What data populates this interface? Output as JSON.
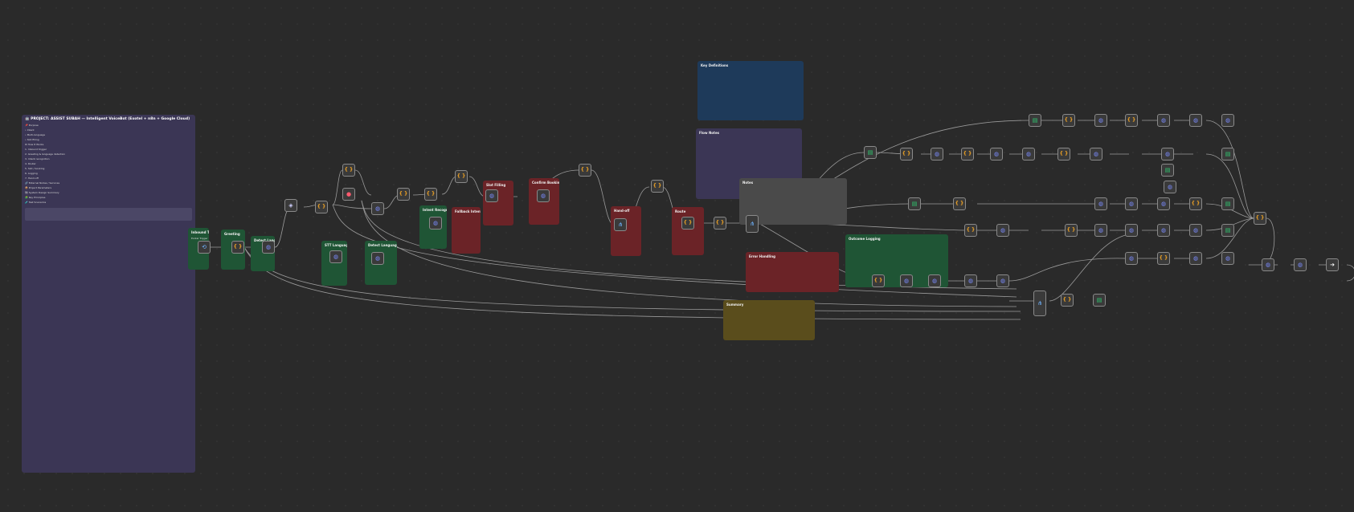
{
  "canvas": {
    "background": "#2a2a2a",
    "wire_color": "#9a9a9a"
  },
  "main_note": {
    "title": "🤖 PROJECT: ASSIST SUBAH — Intelligent VoiceBot (Exotel + n8n + Google Cloud)",
    "color": "#3b3655",
    "lines": [
      "📌 Purpose",
      "",
      "",
      "• Intent",
      "• Multi-language",
      "• Slot filling",
      "",
      "",
      "⚙ How It Works",
      "1. Inbound trigger",
      "",
      "2. Greeting & language detection",
      "",
      "",
      "3. Intent recognition",
      "",
      "",
      "4. Router",
      "",
      "",
      "",
      "",
      "",
      "5. Slot / booking",
      "",
      "",
      "",
      "",
      "6. Logging",
      "",
      "",
      "",
      "7. Hand-off",
      "",
      "",
      "🔗 External Nodes / Services",
      "",
      "",
      "",
      "",
      "",
      "",
      "📦 Project Parameters",
      "",
      "",
      "",
      "",
      "",
      "",
      "",
      "",
      "🗺 System Design Summary",
      "",
      "",
      "",
      "",
      "",
      "🧩 Key Principles",
      "",
      "",
      "",
      "",
      "",
      "🧪 Test Scenarios",
      "",
      ""
    ]
  },
  "notes": [
    {
      "id": "n-inbound",
      "title": "Inbound Trigger",
      "color": "#1f5535",
      "lines": [
        "Exotel Trigger",
        "",
        "",
        ""
      ]
    },
    {
      "id": "n-greet",
      "title": "Greeting",
      "color": "#1f5535",
      "lines": [
        "",
        "",
        "",
        ""
      ]
    },
    {
      "id": "n-lang",
      "title": "Detect Language",
      "color": "#1f5535",
      "lines": [
        "",
        ""
      ]
    },
    {
      "id": "n-lang2",
      "title": "STT Language",
      "color": "#1f5535",
      "lines": [
        "",
        "",
        ""
      ]
    },
    {
      "id": "n-detect-ai",
      "title": "Detect Language (API)",
      "color": "#1f5535",
      "lines": [
        "",
        "",
        ""
      ]
    },
    {
      "id": "n-intent",
      "title": "Intent Recognition",
      "color": "#1f5535",
      "lines": [
        "",
        "",
        ""
      ]
    },
    {
      "id": "n-fallback",
      "title": "Fallback Intent",
      "color": "#6b2327",
      "lines": [
        "",
        "",
        ""
      ]
    },
    {
      "id": "n-slot",
      "title": "Slot Filling",
      "color": "#6b2327",
      "lines": [
        "",
        "",
        ""
      ]
    },
    {
      "id": "n-confirm",
      "title": "Confirm Booking",
      "color": "#6b2327",
      "lines": [
        "",
        "",
        ""
      ]
    },
    {
      "id": "n-handoff",
      "title": "Hand-off",
      "color": "#6b2327",
      "lines": [
        "",
        "",
        ""
      ]
    },
    {
      "id": "n-route",
      "title": "Route",
      "color": "#6b2327",
      "lines": [
        "",
        "",
        ""
      ]
    },
    {
      "id": "n-keydef",
      "title": "Key Definitions",
      "color": "#1e3a5a",
      "lines": [
        "",
        "",
        "",
        "",
        "",
        "",
        "",
        ""
      ]
    },
    {
      "id": "n-flow",
      "title": "Flow Notes",
      "color": "#3b3655",
      "lines": [
        "",
        "",
        "",
        "",
        "",
        "",
        "",
        "",
        "",
        ""
      ]
    },
    {
      "id": "n-grey",
      "title": "Notes",
      "color": "#4a4a4a",
      "lines": [
        "",
        "",
        "",
        "",
        "",
        ""
      ]
    },
    {
      "id": "n-red2",
      "title": "Error Handling",
      "color": "#6b2327",
      "lines": [
        "",
        "",
        "",
        "",
        "",
        ""
      ]
    },
    {
      "id": "n-green2",
      "title": "Outcome Logging",
      "color": "#1f5535",
      "lines": [
        "",
        "",
        "",
        "",
        "",
        "",
        ""
      ]
    },
    {
      "id": "n-yellow",
      "title": "Summary",
      "color": "#5a4d1c",
      "lines": [
        "",
        "",
        "",
        "",
        ""
      ]
    }
  ],
  "nodes": [
    {
      "id": "exotel",
      "icon": "webhook",
      "caption": ""
    },
    {
      "id": "greet-code",
      "icon": "code",
      "caption": ""
    },
    {
      "id": "lang-http",
      "icon": "http",
      "caption": ""
    },
    {
      "id": "tts-node",
      "icon": "ai",
      "caption": ""
    },
    {
      "id": "code-a",
      "icon": "code",
      "caption": ""
    },
    {
      "id": "code-b",
      "icon": "code",
      "caption": ""
    },
    {
      "id": "err-node",
      "icon": "error",
      "caption": ""
    },
    {
      "id": "http-a",
      "icon": "http",
      "caption": ""
    },
    {
      "id": "http-b",
      "icon": "http",
      "caption": ""
    },
    {
      "id": "http-c",
      "icon": "http",
      "caption": ""
    },
    {
      "id": "code-c",
      "icon": "code",
      "caption": ""
    },
    {
      "id": "code-d",
      "icon": "code",
      "caption": ""
    },
    {
      "id": "http-d",
      "icon": "http",
      "caption": ""
    },
    {
      "id": "code-e",
      "icon": "code",
      "caption": ""
    },
    {
      "id": "http-e",
      "icon": "http",
      "caption": ""
    },
    {
      "id": "http-f",
      "icon": "http",
      "caption": ""
    },
    {
      "id": "code-f",
      "icon": "code",
      "caption": ""
    },
    {
      "id": "code-g",
      "icon": "code",
      "caption": ""
    },
    {
      "id": "route-a",
      "icon": "route",
      "caption": ""
    },
    {
      "id": "code-h",
      "icon": "code",
      "caption": ""
    },
    {
      "id": "code-i",
      "icon": "code",
      "caption": ""
    },
    {
      "id": "router",
      "icon": "route",
      "caption": ""
    },
    {
      "id": "s-sheet1",
      "icon": "sheet",
      "caption": ""
    },
    {
      "id": "s-code1",
      "icon": "code",
      "caption": ""
    },
    {
      "id": "s-http1",
      "icon": "http",
      "caption": ""
    },
    {
      "id": "s-code2",
      "icon": "code",
      "caption": ""
    },
    {
      "id": "s-http2",
      "icon": "http",
      "caption": ""
    },
    {
      "id": "s-http3",
      "icon": "http",
      "caption": ""
    },
    {
      "id": "s-code3",
      "icon": "code",
      "caption": ""
    },
    {
      "id": "s-http4",
      "icon": "http",
      "caption": ""
    },
    {
      "id": "s-http5",
      "icon": "http",
      "caption": ""
    },
    {
      "id": "t-sheet",
      "icon": "sheet",
      "caption": ""
    },
    {
      "id": "t-code1",
      "icon": "code",
      "caption": ""
    },
    {
      "id": "t-http1",
      "icon": "http",
      "caption": ""
    },
    {
      "id": "t-code2",
      "icon": "code",
      "caption": ""
    },
    {
      "id": "t-http2",
      "icon": "http",
      "caption": ""
    },
    {
      "id": "t-http3",
      "icon": "http",
      "caption": ""
    },
    {
      "id": "t-http4",
      "icon": "http",
      "caption": ""
    },
    {
      "id": "t-sheet2",
      "icon": "sheet",
      "caption": ""
    },
    {
      "id": "u-sheet",
      "icon": "sheet",
      "caption": ""
    },
    {
      "id": "u-code",
      "icon": "code",
      "caption": ""
    },
    {
      "id": "u-http",
      "icon": "http",
      "caption": ""
    },
    {
      "id": "u-http2",
      "icon": "http",
      "caption": ""
    },
    {
      "id": "u-http3",
      "icon": "http",
      "caption": ""
    },
    {
      "id": "u-code2",
      "icon": "code",
      "caption": ""
    },
    {
      "id": "u-sheet2",
      "icon": "sheet",
      "caption": ""
    },
    {
      "id": "v-code1",
      "icon": "code",
      "caption": ""
    },
    {
      "id": "v-http1",
      "icon": "http",
      "caption": ""
    },
    {
      "id": "v-code2",
      "icon": "code",
      "caption": ""
    },
    {
      "id": "v-http2",
      "icon": "http",
      "caption": ""
    },
    {
      "id": "v-http3",
      "icon": "http",
      "caption": ""
    },
    {
      "id": "v-http4",
      "icon": "http",
      "caption": ""
    },
    {
      "id": "v-http5",
      "icon": "http",
      "caption": ""
    },
    {
      "id": "v-sheet",
      "icon": "sheet",
      "caption": ""
    },
    {
      "id": "w-http1",
      "icon": "http",
      "caption": ""
    },
    {
      "id": "w-code1",
      "icon": "code",
      "caption": ""
    },
    {
      "id": "w-http2",
      "icon": "http",
      "caption": ""
    },
    {
      "id": "w-http3",
      "icon": "http",
      "caption": ""
    },
    {
      "id": "w-sheet",
      "icon": "sheet",
      "caption": ""
    },
    {
      "id": "x-code1",
      "icon": "code",
      "caption": ""
    },
    {
      "id": "x-http1",
      "icon": "http",
      "caption": ""
    },
    {
      "id": "x-http2",
      "icon": "http",
      "caption": ""
    },
    {
      "id": "x-http3",
      "icon": "http",
      "caption": ""
    },
    {
      "id": "x-http4",
      "icon": "http",
      "caption": ""
    },
    {
      "id": "x-http5",
      "icon": "http",
      "caption": ""
    },
    {
      "id": "x-route",
      "icon": "route",
      "caption": ""
    },
    {
      "id": "x-code2",
      "icon": "code",
      "caption": ""
    },
    {
      "id": "x-sheet",
      "icon": "sheet",
      "caption": ""
    },
    {
      "id": "merge",
      "icon": "code",
      "caption": ""
    },
    {
      "id": "y-http1",
      "icon": "http",
      "caption": ""
    },
    {
      "id": "y-http2",
      "icon": "http",
      "caption": ""
    },
    {
      "id": "end",
      "icon": "end",
      "caption": ""
    }
  ]
}
